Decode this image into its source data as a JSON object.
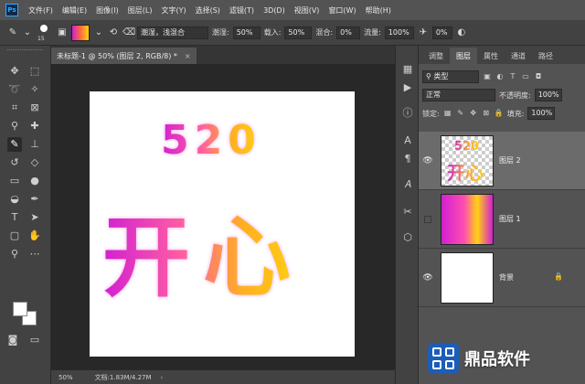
{
  "app": {
    "logo": "Ps"
  },
  "menu": [
    "文件(F)",
    "编辑(E)",
    "图像(I)",
    "图层(L)",
    "文字(Y)",
    "选择(S)",
    "滤镜(T)",
    "3D(D)",
    "视图(V)",
    "窗口(W)",
    "帮助(H)"
  ],
  "options": {
    "brush_size": "15",
    "preset": "潮湿，浅混合",
    "wet_label": "潮湿:",
    "wet_value": "50%",
    "load_label": "载入:",
    "load_value": "50%",
    "mix_label": "混合:",
    "mix_value": "0%",
    "flow_label": "流量:",
    "flow_value": "100%",
    "smooth_value": "0%"
  },
  "document": {
    "tab_title": "未标题-1 @ 50% (图层 2, RGB/8) *",
    "close": "×",
    "art_number": "520",
    "art_text": "开心"
  },
  "status": {
    "zoom": "50%",
    "doc_info": "文档:1.83M/4.27M",
    "arrow": "›"
  },
  "panel": {
    "tabs": [
      "调整",
      "图层",
      "属性",
      "通道",
      "路径"
    ],
    "active_tab": "图层",
    "filter_kind": "类型",
    "blend_mode": "正常",
    "opacity_label": "不透明度:",
    "opacity_value": "100%",
    "lock_label": "锁定:",
    "fill_label": "填充:",
    "fill_value": "100%",
    "layers": [
      {
        "name": "图层 2",
        "visible": true,
        "selected": true,
        "thumb_number": "520",
        "thumb_text": "开心"
      },
      {
        "name": "图层 1",
        "visible": false,
        "selected": false
      },
      {
        "name": "背景",
        "visible": true,
        "selected": false,
        "locked": true
      }
    ]
  },
  "watermark": {
    "text": "鼎品软件"
  },
  "colors": {
    "accent": "#31a8ff",
    "gradient_start": "#d21fd2",
    "gradient_mid": "#ffd20f",
    "ui_dark": "#424242",
    "ui_mid": "#535353",
    "canvas_bg": "#282828"
  }
}
